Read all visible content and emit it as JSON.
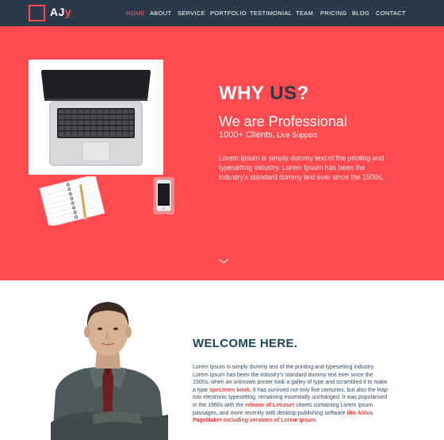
{
  "brand": {
    "text": "AJ",
    "accent": "y"
  },
  "nav": {
    "items": [
      {
        "label": "HOME",
        "active": true
      },
      {
        "label": "ABOUT",
        "active": false
      },
      {
        "label": "SERVICE",
        "active": false
      },
      {
        "label": "PORTFOLIO",
        "active": false
      },
      {
        "label": "TESTIMONIAL",
        "active": false
      },
      {
        "label": "TEAM",
        "active": false
      },
      {
        "label": "PRICING",
        "active": false
      },
      {
        "label": "BLOG",
        "active": false
      },
      {
        "label": "CONTACT",
        "active": false
      }
    ]
  },
  "hero": {
    "title_prefix": "WHY ",
    "title_highlight": "US",
    "title_suffix": "?",
    "subtitle": "We are Professional",
    "clients": "1000+ Clients,",
    "clients_small": " Live Support",
    "body": "Lorem Ipsum is simply dummy text of the printing and typesetting industry. Lorem Ipsum has been the industry's standard dummy text ever since the 1500s,"
  },
  "welcome": {
    "title": "WELCOME HERE",
    "title_dot": ".",
    "body_1": "Lorem Ipsum is simply dummy text of the printing and typesetting industry. Lorem Ipsum has been the industry's standard dummy text ever since the 1500s, when an unknown printer took a galley of type and scrambled it to make a type ",
    "highlight_1": "specimen book",
    "body_2": ". It has survived not only five centuries, but also the leap into electronic typesetting, remaining essentially unchanged. It was popularised in the 1960s with the ",
    "highlight_2": "release of Letraset",
    "body_3": " sheets containing Lorem Ipsum passages, and more recently with desktop publishing software ",
    "highlight_3": "like Aldus PageMaker including versions of Lorem Ipsum",
    "body_4": "."
  },
  "colors": {
    "navbar_bg": "#2b3a4a",
    "hero_bg": "#ff4a4f",
    "accent": "#ff4a4f",
    "heading_dark": "#19465a"
  }
}
